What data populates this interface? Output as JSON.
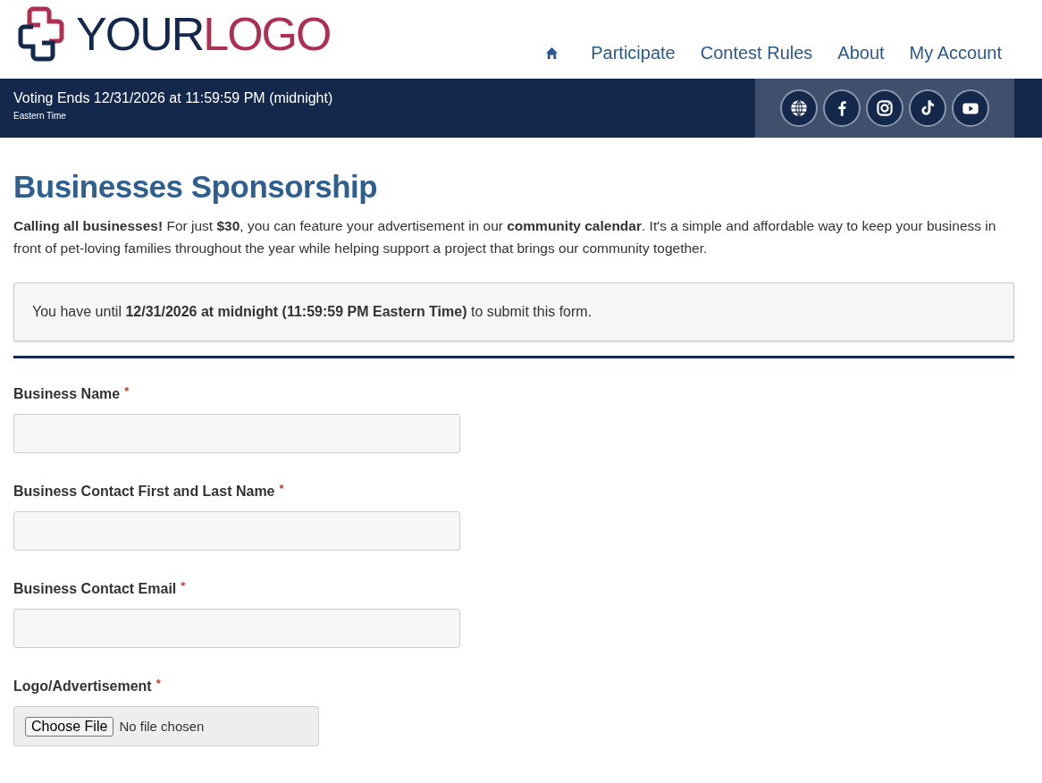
{
  "logo": {
    "part_1": "YOUR",
    "part_2": "LOGO"
  },
  "nav": [
    {
      "kind": "home"
    },
    {
      "label": "Participate"
    },
    {
      "label": "Contest Rules"
    },
    {
      "label": "About"
    },
    {
      "label": "My Account"
    }
  ],
  "banner": {
    "title": "Voting Ends 12/31/2026 at 11:59:59 PM (midnight)",
    "subtitle": "Eastern Time"
  },
  "heading": "Businesses Sponsorship",
  "intro": "**Calling all businesses!** For just **$30**, you can feature your advertisement in our **community calendar**. It's a simple and affordable way to keep your business in front of pet-loving families throughout the year while helping support a project that brings our community together.",
  "notice": "You have until **12/31/2026 at midnight (11:59:59 PM Eastern Time)** to submit this form.",
  "fields": [
    {
      "kind": "text",
      "label": "Business Name",
      "required_mark": "*"
    },
    {
      "kind": "text",
      "label": "Business Contact First and Last Name",
      "required_mark": "*"
    },
    {
      "kind": "text",
      "label": "Business Contact Email",
      "required_mark": "*"
    },
    {
      "kind": "file",
      "label": "Logo/Advertisement",
      "required_mark": "*",
      "button": "Choose File",
      "status": "No file chosen"
    }
  ]
}
